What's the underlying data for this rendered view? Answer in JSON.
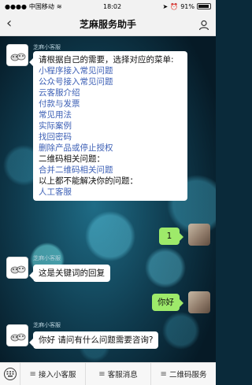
{
  "status_bar": {
    "carrier": "中国移动",
    "time": "18:02",
    "battery": "91%"
  },
  "nav": {
    "back_icon": "chevron-left-icon",
    "title": "芝麻服务助手",
    "profile_icon": "person-icon"
  },
  "messages": {
    "m1": {
      "sender": "芝麻小客服",
      "intro": "请根据自己的需要，选择对应的菜单:",
      "links": [
        "小程序接入常见问题",
        "公众号接入常见问题",
        "云客服介绍",
        "付款与发票",
        "常见用法",
        "实际案例",
        "找回密码",
        "删除产品或停止授权"
      ],
      "qr_heading": "二维码相关问题：",
      "qr_link": "合并二维码相关问题",
      "other_heading": "以上都不能解决你的问题：",
      "human_link": "人工客服"
    },
    "m2": {
      "text": "1"
    },
    "m3": {
      "sender": "芝麻小客服",
      "text": "这是关键词的回复"
    },
    "m4": {
      "text": "你好"
    },
    "m5": {
      "sender": "芝麻小客服",
      "text": "你好 请问有什么问题需要咨询?"
    }
  },
  "toolbar": {
    "keyboard_icon": "keyboard-icon",
    "items": [
      "接入小客服",
      "客服消息",
      "二维码服务"
    ]
  },
  "colors": {
    "link": "#3c5fb5",
    "outgoing_bubble": "#9eea6a",
    "nav_bg": "#f2f2f2"
  }
}
